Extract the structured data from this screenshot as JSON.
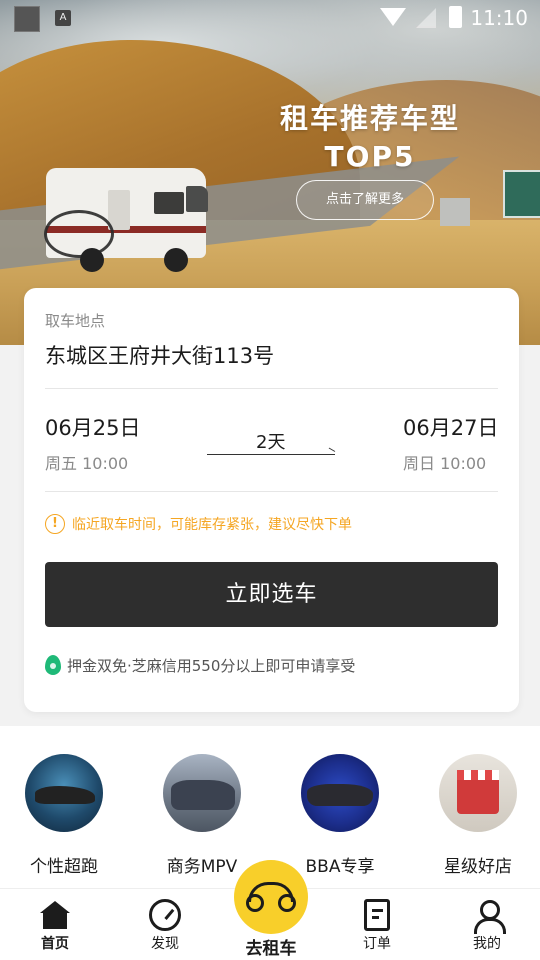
{
  "status_bar": {
    "time": "11:10",
    "keyboard_badge": "A"
  },
  "hero": {
    "title_line1": "租车推荐车型",
    "title_line2": "TOP5",
    "cta_label": "点击了解更多"
  },
  "booking": {
    "pickup_label": "取车地点",
    "pickup_address": "东城区王府井大街113号",
    "start_date": "06月25日",
    "start_sub": "周五 10:00",
    "duration": "2天",
    "end_date": "06月27日",
    "end_sub": "周日 10:00",
    "warning_text": "临近取车时间，可能库存紧张，建议尽快下单",
    "submit_label": "立即选车",
    "deposit_text": "押金双免·芝麻信用550分以上即可申请享受"
  },
  "categories": [
    {
      "label": "个性超跑",
      "icon": "sports-car-icon"
    },
    {
      "label": "商务MPV",
      "icon": "mpv-icon"
    },
    {
      "label": "BBA专享",
      "icon": "luxury-car-icon"
    },
    {
      "label": "星级好店",
      "icon": "store-icon"
    }
  ],
  "nav": {
    "items": [
      {
        "label": "首页",
        "icon": "home-icon"
      },
      {
        "label": "发现",
        "icon": "compass-icon"
      },
      {
        "label": "去租车",
        "icon": "rent-car-icon"
      },
      {
        "label": "订单",
        "icon": "order-icon"
      },
      {
        "label": "我的",
        "icon": "profile-icon"
      }
    ],
    "active": "首页"
  },
  "colors": {
    "accent": "#f8cf2a",
    "warning": "#f5a623",
    "primary_button": "#2e2e2e",
    "deposit_icon": "#1fb978"
  }
}
